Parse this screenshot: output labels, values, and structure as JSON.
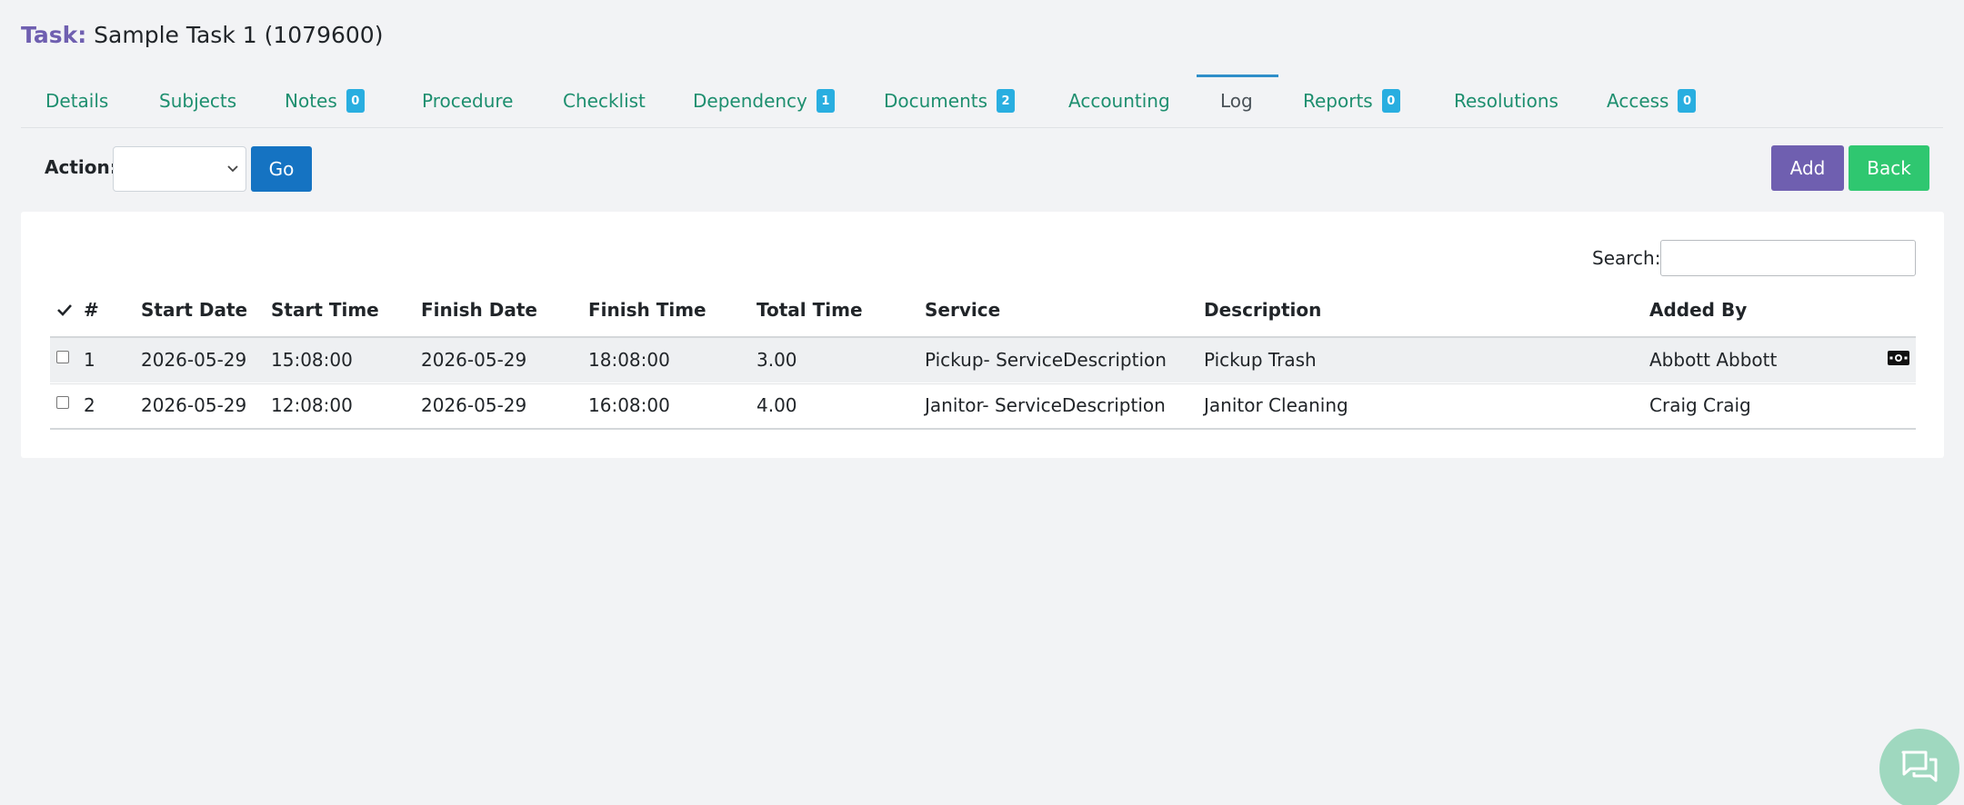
{
  "header": {
    "label": "Task:",
    "task_name": "Sample Task 1 (1079600)"
  },
  "tabs": [
    {
      "label": "Details"
    },
    {
      "label": "Subjects"
    },
    {
      "label": "Notes",
      "badge": "0"
    },
    {
      "label": "Procedure"
    },
    {
      "label": "Checklist"
    },
    {
      "label": "Dependency",
      "badge": "1"
    },
    {
      "label": "Documents",
      "badge": "2"
    },
    {
      "label": "Accounting"
    },
    {
      "label": "Log",
      "active": true
    },
    {
      "label": "Reports",
      "badge": "0"
    },
    {
      "label": "Resolutions"
    },
    {
      "label": "Access",
      "badge": "0"
    }
  ],
  "toolbar": {
    "action_label": "Action:",
    "action_value": "",
    "go_label": "Go",
    "add_label": "Add",
    "back_label": "Back"
  },
  "search": {
    "label": "Search:",
    "value": ""
  },
  "table": {
    "columns": [
      "#",
      "Start Date",
      "Start Time",
      "Finish Date",
      "Finish Time",
      "Total Time",
      "Service",
      "Description",
      "Added By"
    ],
    "rows": [
      {
        "num": "1",
        "start_date": "2026-05-29",
        "start_time": "15:08:00",
        "finish_date": "2026-05-29",
        "finish_time": "18:08:00",
        "total_time": "3.00",
        "service": "Pickup- ServiceDescription",
        "description": "Pickup Trash",
        "added_by": "Abbott Abbott",
        "icon": "money-bill-icon"
      },
      {
        "num": "2",
        "start_date": "2026-05-29",
        "start_time": "12:08:00",
        "finish_date": "2026-05-29",
        "finish_time": "16:08:00",
        "total_time": "4.00",
        "service": "Janitor- ServiceDescription",
        "description": "Janitor Cleaning",
        "added_by": "Craig Craig"
      }
    ]
  },
  "colors": {
    "accent_purple": "#6f5fb0",
    "tab_green": "#1e8f6f",
    "badge_blue": "#29aee0",
    "go_blue": "#1573c2",
    "back_green": "#2fc770"
  }
}
